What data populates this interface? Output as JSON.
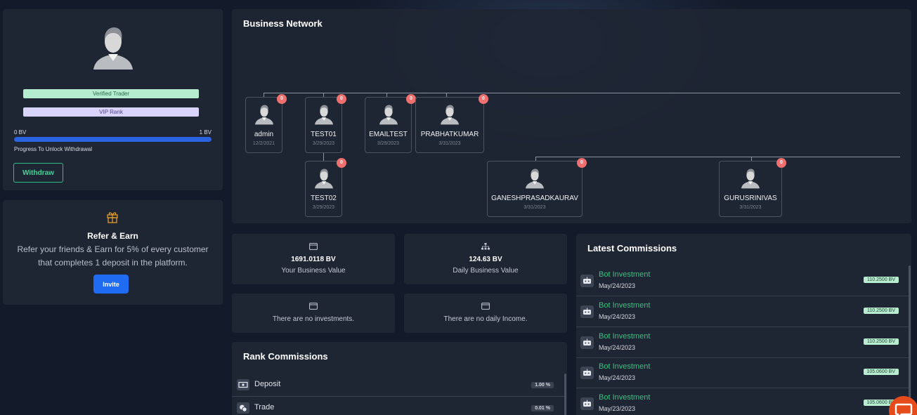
{
  "profile": {
    "badges": {
      "verified": "Verified Trader",
      "vip": "VIP Rank"
    },
    "bv_min": "0 BV",
    "bv_max": "1 BV",
    "progress_fraction": 1.0,
    "progress_label": "Progress To Unlock Withdrawal",
    "withdraw_label": "Withdraw"
  },
  "refer": {
    "title": "Refer & Earn",
    "text": "Refer your friends & Earn for 5% of every customer that completes 1 deposit in the platform.",
    "invite_label": "Invite"
  },
  "network": {
    "title": "Business Network",
    "nodes": [
      {
        "name": "admin",
        "date": "12/2/2021",
        "badge": "0"
      },
      {
        "name": "TEST01",
        "date": "3/29/2023",
        "badge": "0"
      },
      {
        "name": "EMAILTEST",
        "date": "3/29/2023",
        "badge": "0"
      },
      {
        "name": "PRABHATKUMAR",
        "date": "3/31/2023",
        "badge": "0"
      },
      {
        "name": "TEST02",
        "date": "3/29/2023",
        "badge": "0"
      },
      {
        "name": "GANESHPRASADKAURAV",
        "date": "3/31/2023",
        "badge": "0"
      },
      {
        "name": "GURUSRINIVAS",
        "date": "3/31/2023",
        "badge": "0"
      }
    ]
  },
  "stats": {
    "business_value": "1691.0118 BV",
    "business_value_label": "Your Business Value",
    "daily_value": "124.63 BV",
    "daily_value_label": "Daily Business Value",
    "no_investments": "There are no investments.",
    "no_daily_income": "There are no daily Income."
  },
  "rank": {
    "title": "Rank Commissions",
    "rows": [
      {
        "name": "Deposit",
        "percent": "1.00 %"
      },
      {
        "name": "Trade",
        "percent": "0.01 %"
      }
    ]
  },
  "commissions": {
    "title": "Latest Commissions",
    "rows": [
      {
        "name": "Bot Investment",
        "date": "May/24/2023",
        "amount": "110.2500 BV"
      },
      {
        "name": "Bot Investment",
        "date": "May/24/2023",
        "amount": "110.2500 BV"
      },
      {
        "name": "Bot Investment",
        "date": "May/24/2023",
        "amount": "110.2500 BV"
      },
      {
        "name": "Bot Investment",
        "date": "May/24/2023",
        "amount": "105.0600 BV"
      },
      {
        "name": "Bot Investment",
        "date": "May/23/2023",
        "amount": "105.0600 BV"
      }
    ]
  },
  "colors": {
    "accent_blue": "#1f6bf2",
    "accent_green": "#35c27f",
    "badge_red": "#f07070",
    "card_bg": "#1f2633"
  }
}
